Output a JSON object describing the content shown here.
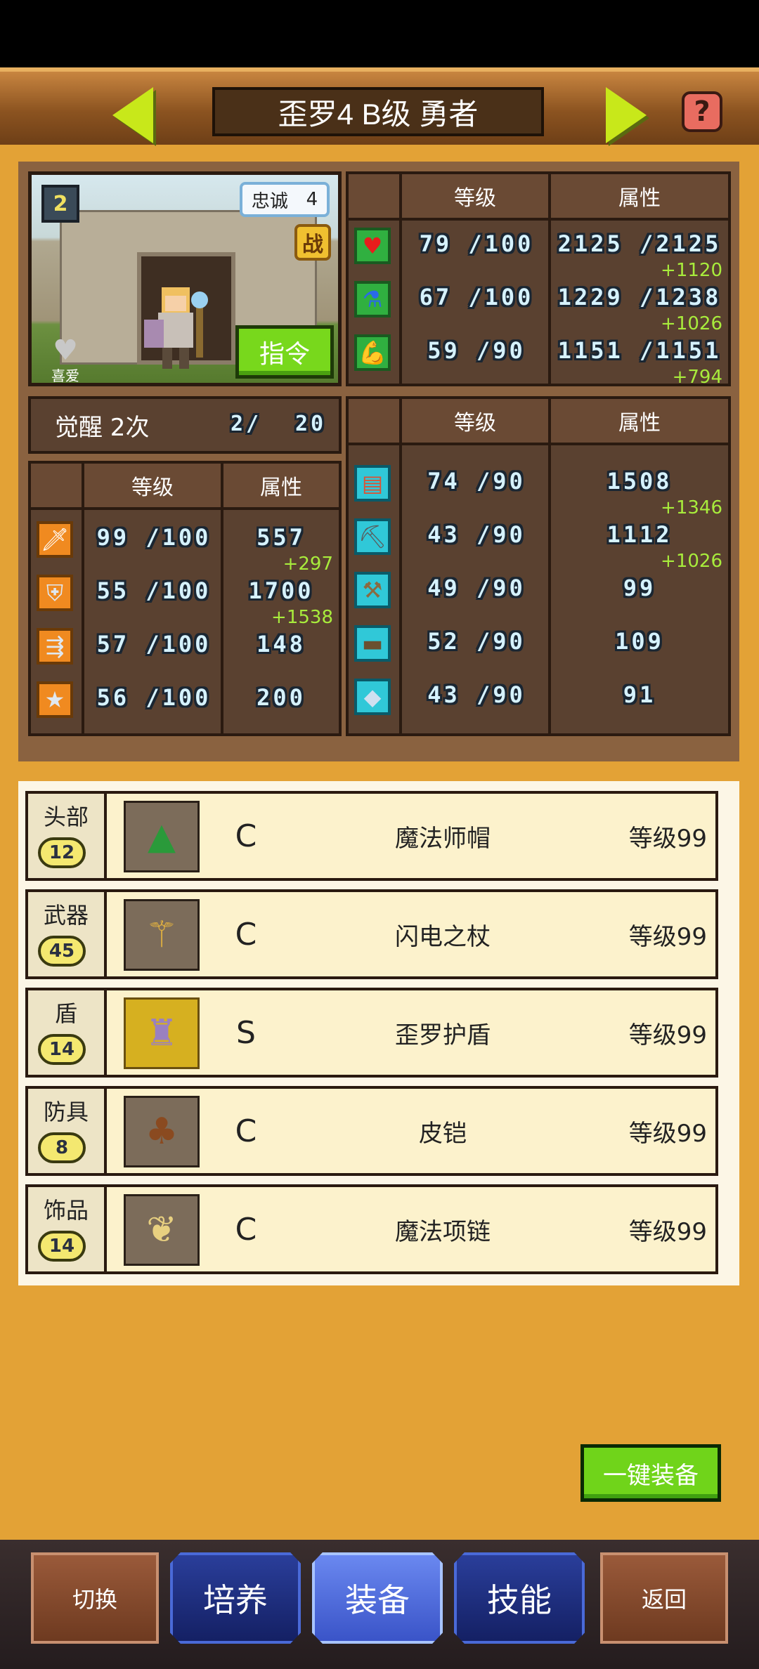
{
  "header": {
    "title": "歪罗4 B级 勇者",
    "help_glyph": "?"
  },
  "hero": {
    "level_badge": "2",
    "loyalty_label": "忠诚",
    "loyalty_value": "4",
    "battle_glyph": "战",
    "favorite_label": "喜爱",
    "command_label": "指令"
  },
  "vitals": {
    "col_level": "等级",
    "col_attr": "属性",
    "rows": [
      {
        "icon": "heart-icon",
        "level": "79 /100",
        "attr": "2125 /2125",
        "bonus": "+1120"
      },
      {
        "icon": "potion-icon",
        "level": "67 /100",
        "attr": "1229 /1238",
        "bonus": "+1026"
      },
      {
        "icon": "stamina-icon",
        "level": "59 /90",
        "attr": "1151 /1151",
        "bonus": "+794"
      }
    ]
  },
  "awaken": {
    "label": "觉醒 2次",
    "count": "2/",
    "max": "20"
  },
  "combat": {
    "col_level": "等级",
    "col_attr": "属性",
    "rows": [
      {
        "icon": "sword-icon",
        "level": "99 /100",
        "attr": "557",
        "bonus": "+297"
      },
      {
        "icon": "shield-icon",
        "level": "55 /100",
        "attr": "1700",
        "bonus": "+1538"
      },
      {
        "icon": "speed-icon",
        "level": "57 /100",
        "attr": "148",
        "bonus": ""
      },
      {
        "icon": "star-icon",
        "level": "56 /100",
        "attr": "200",
        "bonus": ""
      }
    ]
  },
  "skills": {
    "col_level": "等级",
    "col_attr": "属性",
    "rows": [
      {
        "icon": "book-icon",
        "level": "74 /90",
        "attr": "1508",
        "bonus": "+1346"
      },
      {
        "icon": "pickaxe-icon",
        "level": "43 /90",
        "attr": "1112",
        "bonus": "+1026"
      },
      {
        "icon": "shovel-icon",
        "level": "49 /90",
        "attr": "99",
        "bonus": ""
      },
      {
        "icon": "anvil-icon",
        "level": "52 /90",
        "attr": "109",
        "bonus": ""
      },
      {
        "icon": "gem-icon",
        "level": "43 /90",
        "attr": "91",
        "bonus": ""
      }
    ]
  },
  "equipment": [
    {
      "slot": "头部",
      "slot_level": "12",
      "rank": "C",
      "name": "魔法师帽",
      "level": "等级99",
      "glyph": "▲"
    },
    {
      "slot": "武器",
      "slot_level": "45",
      "rank": "C",
      "name": "闪电之杖",
      "level": "等级99",
      "glyph": "⚚"
    },
    {
      "slot": "盾",
      "slot_level": "14",
      "rank": "S",
      "name": "歪罗护盾",
      "level": "等级99",
      "glyph": "♜"
    },
    {
      "slot": "防具",
      "slot_level": "8",
      "rank": "C",
      "name": "皮铠",
      "level": "等级99",
      "glyph": "♣"
    },
    {
      "slot": "饰品",
      "slot_level": "14",
      "rank": "C",
      "name": "魔法项链",
      "level": "等级99",
      "glyph": "❦"
    }
  ],
  "auto_equip_label": "一键装备",
  "nav": {
    "switch": "切换",
    "train": "培养",
    "equip": "装备",
    "skill": "技能",
    "back": "返回"
  },
  "colors": {
    "accent_green": "#78d81c",
    "bonus_green": "#a8ec3c",
    "background": "#e3a236"
  }
}
